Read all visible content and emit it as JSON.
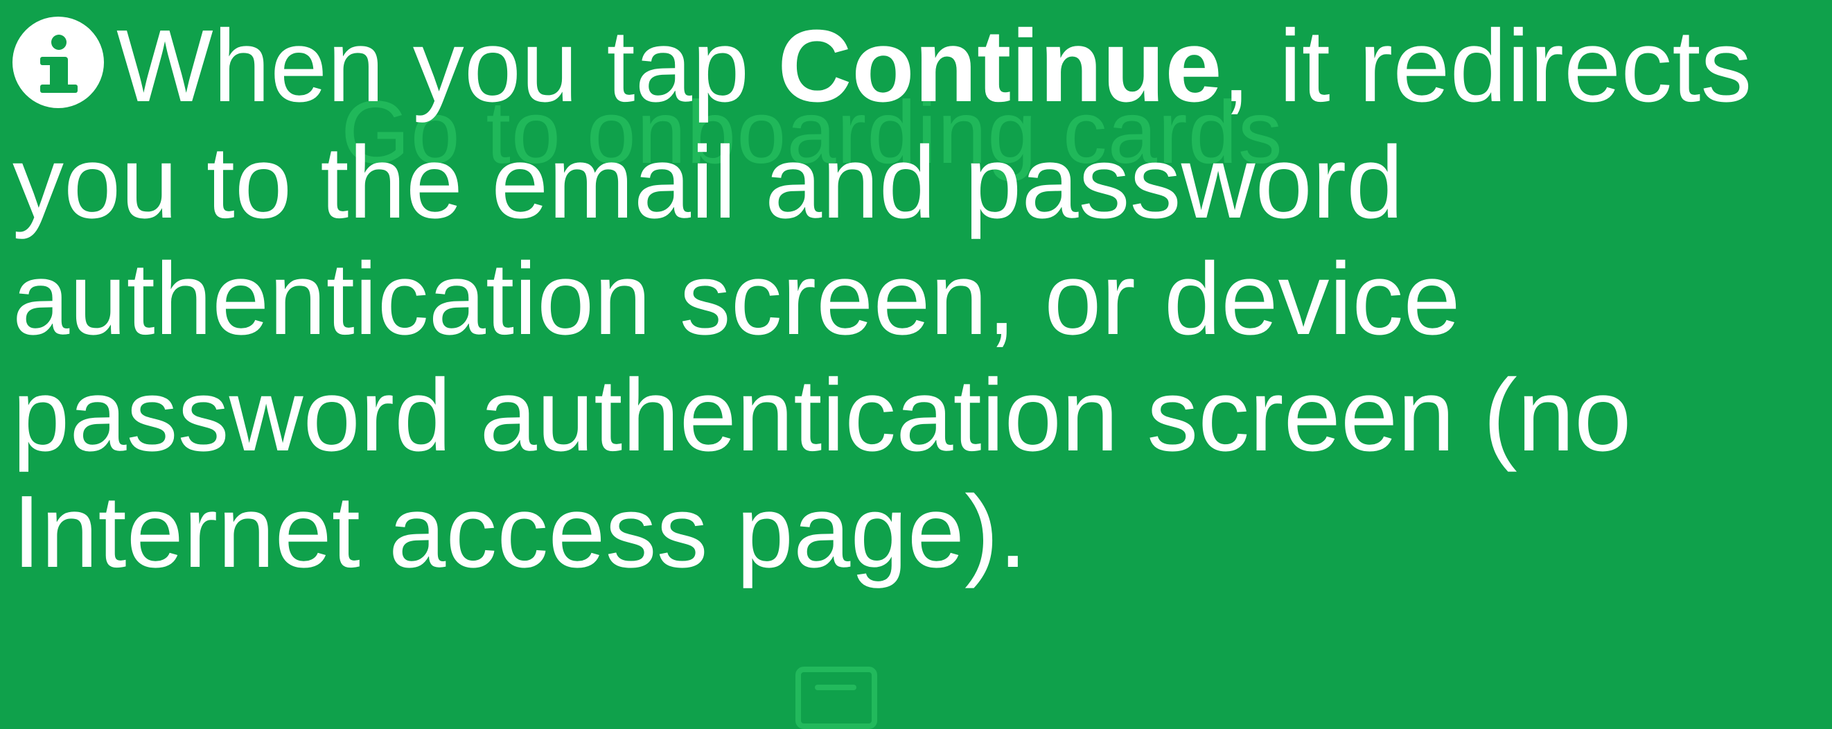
{
  "background_title": "Go to onboarding cards",
  "info": {
    "icon": "info-icon",
    "text_before": "When you tap ",
    "bold": "Continue",
    "text_after": ", it redirects you to the email and password authentication screen, or device password authentication screen (no Internet access page)."
  },
  "colors": {
    "background": "#0FA14B",
    "text": "#FFFFFF",
    "ghost": "#20B85A"
  }
}
